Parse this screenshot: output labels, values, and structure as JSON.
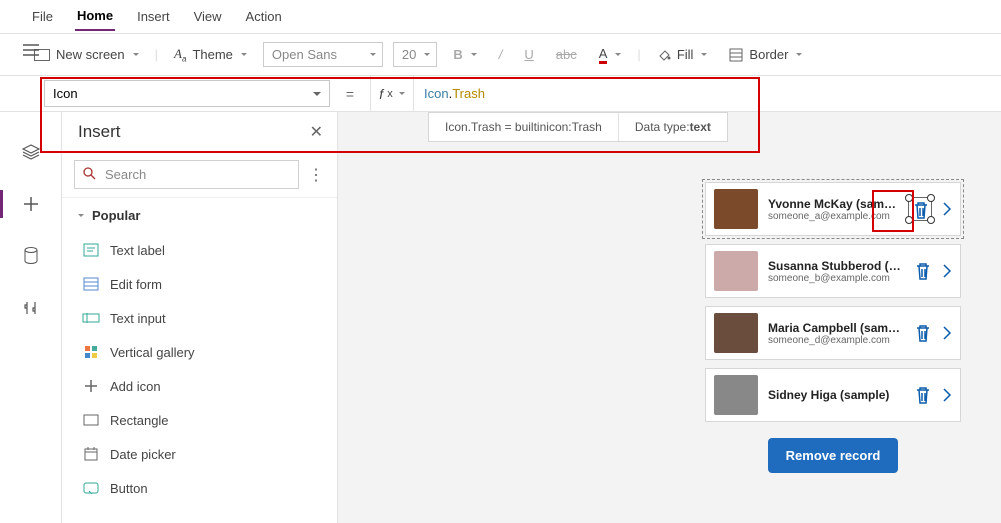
{
  "tabs": {
    "file": "File",
    "home": "Home",
    "insert": "Insert",
    "view": "View",
    "action": "Action"
  },
  "ribbon": {
    "new_screen": "New screen",
    "theme": "Theme",
    "font": "Open Sans",
    "size": "20",
    "fill": "Fill",
    "border": "Border"
  },
  "formula": {
    "property": "Icon",
    "expr_type": "Icon",
    "expr_dot": ".",
    "expr_prop": "Trash",
    "hint_eval": "Icon.Trash  =  builtinicon:Trash",
    "hint_type_label": "Data type: ",
    "hint_type": "text"
  },
  "insert_panel": {
    "title": "Insert",
    "search_placeholder": "Search",
    "category": "Popular",
    "items": [
      "Text label",
      "Edit form",
      "Text input",
      "Vertical gallery",
      "Add icon",
      "Rectangle",
      "Date picker",
      "Button"
    ]
  },
  "gallery": [
    {
      "name": "Yvonne McKay (sample)",
      "email": "someone_a@example.com"
    },
    {
      "name": "Susanna Stubberod (sample)",
      "email": "someone_b@example.com"
    },
    {
      "name": "Maria Campbell (sample)",
      "email": "someone_d@example.com"
    },
    {
      "name": "Sidney Higa (sample)",
      "email": ""
    }
  ],
  "remove_button": "Remove record"
}
